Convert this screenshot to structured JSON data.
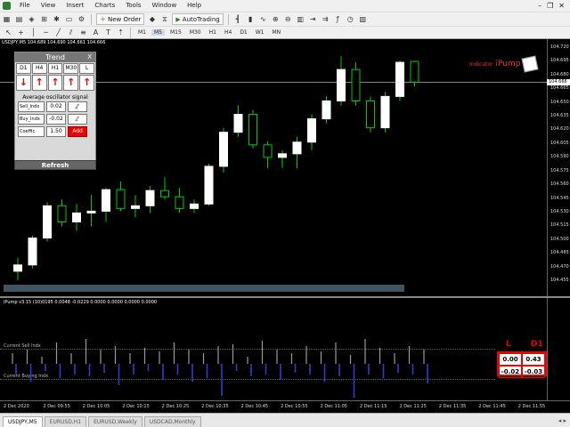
{
  "menu": {
    "items": [
      "File",
      "View",
      "Insert",
      "Charts",
      "Tools",
      "Window",
      "Help"
    ]
  },
  "toolbar": {
    "new_order": "New Order",
    "auto_trading": "AutoTrading",
    "timeframes": [
      "M1",
      "M5",
      "M15",
      "M30",
      "H1",
      "H4",
      "D1",
      "W1",
      "MN"
    ],
    "active_timeframe": "M5"
  },
  "chart": {
    "title": "USDJPY,M5  104.689 104.690 104.661 104.666",
    "price_labels": [
      "104.720",
      "104.695",
      "104.680",
      "104.665",
      "104.650",
      "104.635",
      "104.620",
      "104.605",
      "104.590",
      "104.575",
      "104.560",
      "104.545",
      "104.530",
      "104.515",
      "104.500",
      "104.485",
      "104.470",
      "104.455"
    ],
    "current_price": "104.666",
    "up_color": "#ffffff",
    "down_color": "#00cc00",
    "candles": [
      {
        "o": 104.455,
        "h": 104.47,
        "l": 104.445,
        "c": 104.462
      },
      {
        "o": 104.462,
        "h": 104.495,
        "l": 104.458,
        "c": 104.492
      },
      {
        "o": 104.492,
        "h": 104.532,
        "l": 104.488,
        "c": 104.528
      },
      {
        "o": 104.528,
        "h": 104.535,
        "l": 104.505,
        "c": 104.51
      },
      {
        "o": 104.51,
        "h": 104.53,
        "l": 104.5,
        "c": 104.52
      },
      {
        "o": 104.52,
        "h": 104.54,
        "l": 104.505,
        "c": 104.522
      },
      {
        "o": 104.522,
        "h": 104.548,
        "l": 104.51,
        "c": 104.546
      },
      {
        "o": 104.546,
        "h": 104.555,
        "l": 104.522,
        "c": 104.525
      },
      {
        "o": 104.525,
        "h": 104.54,
        "l": 104.515,
        "c": 104.528
      },
      {
        "o": 104.528,
        "h": 104.55,
        "l": 104.52,
        "c": 104.545
      },
      {
        "o": 104.545,
        "h": 104.56,
        "l": 104.535,
        "c": 104.538
      },
      {
        "o": 104.538,
        "h": 104.548,
        "l": 104.52,
        "c": 104.525
      },
      {
        "o": 104.525,
        "h": 104.535,
        "l": 104.52,
        "c": 104.53
      },
      {
        "o": 104.53,
        "h": 104.575,
        "l": 104.528,
        "c": 104.572
      },
      {
        "o": 104.572,
        "h": 104.615,
        "l": 104.565,
        "c": 104.61
      },
      {
        "o": 104.61,
        "h": 104.64,
        "l": 104.605,
        "c": 104.63
      },
      {
        "o": 104.63,
        "h": 104.635,
        "l": 104.592,
        "c": 104.596
      },
      {
        "o": 104.596,
        "h": 104.6,
        "l": 104.57,
        "c": 104.582
      },
      {
        "o": 104.582,
        "h": 104.59,
        "l": 104.57,
        "c": 104.586
      },
      {
        "o": 104.586,
        "h": 104.605,
        "l": 104.57,
        "c": 104.599
      },
      {
        "o": 104.599,
        "h": 104.63,
        "l": 104.59,
        "c": 104.625
      },
      {
        "o": 104.625,
        "h": 104.65,
        "l": 104.62,
        "c": 104.645
      },
      {
        "o": 104.645,
        "h": 104.695,
        "l": 104.64,
        "c": 104.68
      },
      {
        "o": 104.68,
        "h": 104.688,
        "l": 104.64,
        "c": 104.645
      },
      {
        "o": 104.645,
        "h": 104.65,
        "l": 104.61,
        "c": 104.615
      },
      {
        "o": 104.615,
        "h": 104.655,
        "l": 104.61,
        "c": 104.65
      },
      {
        "o": 104.65,
        "h": 104.69,
        "l": 104.645,
        "c": 104.688
      },
      {
        "o": 104.689,
        "h": 104.69,
        "l": 104.661,
        "c": 104.666
      }
    ]
  },
  "trend_panel": {
    "title": "Trend",
    "close": "X",
    "timeframes": [
      "D1",
      "H4",
      "H1",
      "M30",
      "L"
    ],
    "arrows": [
      "↓",
      "↑",
      "↑",
      "↑",
      "↑"
    ],
    "oscillator_title": "Average oscillator signal",
    "sell_label": "Sell_Indx",
    "sell_value": "0.02",
    "buy_label": "Buy_Indx",
    "buy_value": "-0.02",
    "coeff_label": "Coeffic.",
    "coeff_value": "1.50",
    "add_label": "Add",
    "refresh": "Refresh"
  },
  "logo": {
    "small": "Indicator",
    "big": "iPump"
  },
  "subwindow": {
    "title": "iPump v3.15 (10)0195 0.0048 -0.0229 0.0000 0.0000 0.0000 0.0000",
    "sell_line_label": "Current Sell Indx",
    "buy_line_label": "Current Buying Indx",
    "gray_bars": [
      0.3,
      0.4,
      0.2,
      0.6,
      0.3,
      0.7,
      0.4,
      0.5,
      0.3,
      0.45,
      0.35,
      0.6,
      0.4,
      0.3,
      0.5,
      0.55,
      0.2,
      0.65,
      0.4,
      0.3,
      0.5,
      0.35,
      0.6,
      0.25,
      0.7,
      0.45,
      0.3,
      0.5,
      0.4
    ],
    "blue_bars": [
      0.3,
      0.5,
      0.2,
      0.4,
      0.3,
      0.35,
      0.25,
      0.6,
      0.3,
      0.2,
      0.45,
      0.3,
      0.5,
      0.4,
      0.9,
      0.2,
      0.35,
      0.3,
      0.45,
      0.25,
      0.3,
      0.5,
      0.35,
      0.95,
      0.3,
      0.4,
      0.25,
      0.3,
      0.55
    ]
  },
  "ld_table": {
    "col_l": "L",
    "col_d1": "D1",
    "r1_l": "0.00",
    "r1_d1": "0.43",
    "r2_l": "-0.02",
    "r2_d1": "-0.03"
  },
  "time_axis": [
    "2 Dec 2020",
    "2 Dec 09:55",
    "2 Dec 10:05",
    "2 Dec 10:15",
    "2 Dec 10:25",
    "2 Dec 10:35",
    "2 Dec 10:45",
    "2 Dec 10:55",
    "2 Dec 11:05",
    "2 Dec 11:15",
    "2 Dec 11:25",
    "2 Dec 11:35",
    "2 Dec 11:45",
    "2 Dec 11:55"
  ],
  "tabs": [
    "USDJPY,M5",
    "EURUSD,H1",
    "EURUSD,Weekly",
    "USDCAD,Monthly"
  ],
  "active_tab": "USDJPY,M5"
}
